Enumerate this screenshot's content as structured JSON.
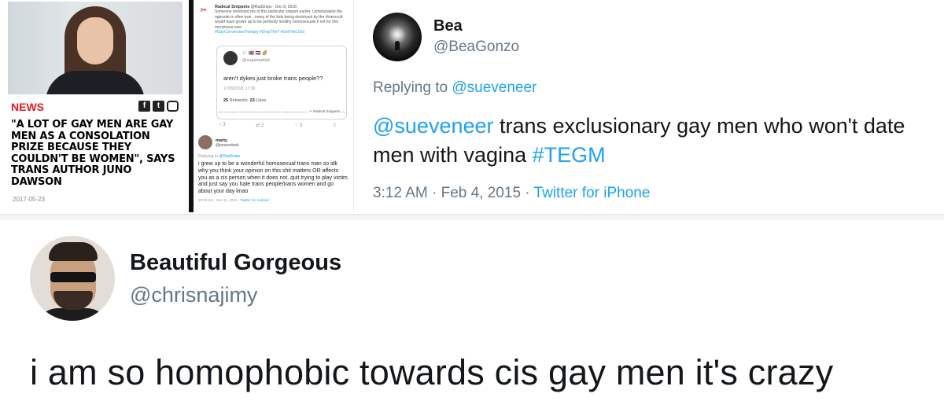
{
  "news_card": {
    "label": "NEWS",
    "socials": [
      "f",
      "t",
      "ig"
    ],
    "headline": "\"A LOT OF GAY MEN ARE GAY MEN AS A CONSOLATION PRIZE BECAUSE THEY COULDN'T BE WOMEN\", SAYS TRANS AUTHOR JUNO DAWSON",
    "date": "2017-05-23"
  },
  "thread": {
    "snip_name": "Radical Snippets",
    "snip_handle_date": "@RadSnips · Dec 8, 2018",
    "snip_body": "Someone reminded me of this particular snippet earlier. Unfortunately the opposite is often true - many of the kids being destroyed by the #transcult would have grown up to be perfectly healthy homosexuals if not for this monstrous new",
    "snip_tags": "#GayConversionTherapy #DropTheT #GetTheLOut",
    "quote": {
      "emojis": "🏳️ 🇬🇧 🇳🇱 🌈",
      "handle": "@sugadaddyk",
      "text": "aren't dykes just broke trans people??",
      "date": "17/09/2018, 17:36",
      "retweets_count": "25",
      "retweets_label": "Retweets",
      "likes_count": "23",
      "likes_label": "Likes",
      "cut_label": "✂ Radical Snippets"
    },
    "actions": [
      "○ 3",
      "⇄ 2",
      "♡ 3",
      "⇪"
    ],
    "reply": {
      "name": "marty",
      "handle": "@powerdeek",
      "replying_prefix": "Replying to",
      "replying_to": "@RadSnips",
      "text": "i grew up to be a wonderful homosexual trans man so idk why you think your opinion on this shit matters OR affects you as a cis person when it does not. quit trying to play victim and just say you hate trans people/trans women and go about your day lmao",
      "time": "10:25 AM · Dec 11, 2018 ·",
      "client": "Twitter for Android"
    }
  },
  "bea_tweet": {
    "name": "Bea",
    "handle": "@BeaGonzo",
    "replying_prefix": "Replying to",
    "replying_to": "@sueveneer",
    "mention": "@sueveneer",
    "body": " trans exclusionary gay men who won't date men with vagina ",
    "hashtag": "#TEGM",
    "time": "3:12 AM · Feb 4, 2015 · ",
    "client": "Twitter for iPhone"
  },
  "bg_tweet": {
    "name": "Beautiful Gorgeous",
    "handle": "@chrisnajimy",
    "text": "i am so homophobic towards cis gay men it's crazy"
  },
  "colors": {
    "link": "#1da1f2",
    "secondary_text": "#657786",
    "news_red": "#e01b22"
  }
}
